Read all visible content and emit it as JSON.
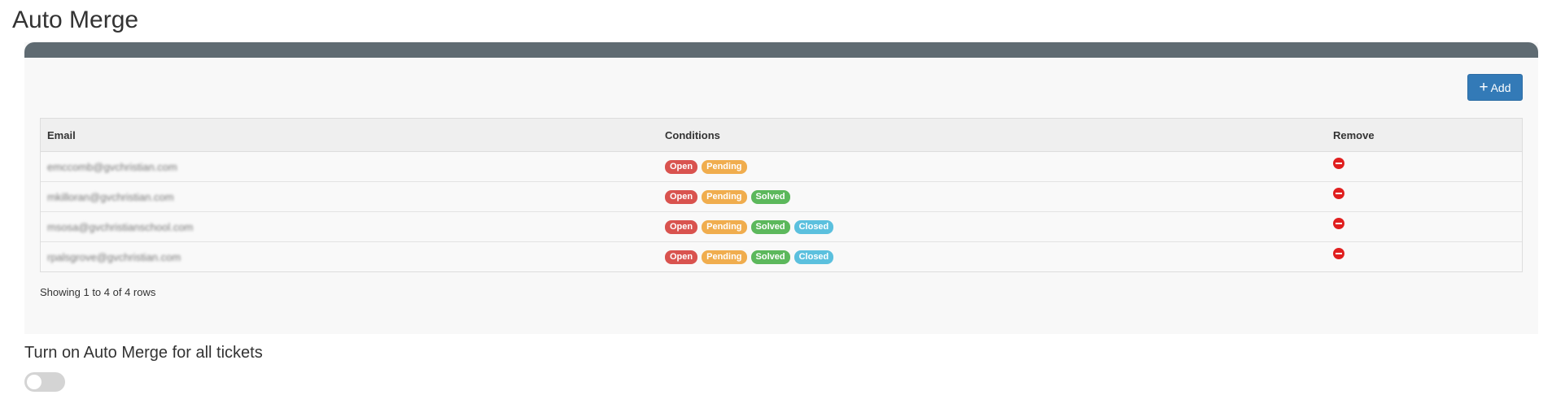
{
  "page": {
    "title": "Auto Merge"
  },
  "toolbar": {
    "add_label": "Add"
  },
  "table": {
    "columns": [
      "Email",
      "Conditions",
      "Remove"
    ],
    "rows": [
      {
        "email": "emccomb@gvchristian.com",
        "conditions": [
          "Open",
          "Pending"
        ]
      },
      {
        "email": "mkilloran@gvchristian.com",
        "conditions": [
          "Open",
          "Pending",
          "Solved"
        ]
      },
      {
        "email": "msosa@gvchristianschool.com",
        "conditions": [
          "Open",
          "Pending",
          "Solved",
          "Closed"
        ]
      },
      {
        "email": "rpalsgrove@gvchristian.com",
        "conditions": [
          "Open",
          "Pending",
          "Solved",
          "Closed"
        ]
      }
    ],
    "footer": "Showing 1 to 4 of 4 rows"
  },
  "settings": {
    "auto_merge_label": "Turn on Auto Merge for all tickets",
    "auto_merge_enabled": false
  },
  "colors": {
    "header_bar": "#5f6b72",
    "primary": "#337ab7",
    "open": "#d9534f",
    "pending": "#f0ad4e",
    "solved": "#5cb85c",
    "closed": "#5bc0de",
    "remove": "#e01f1f"
  }
}
